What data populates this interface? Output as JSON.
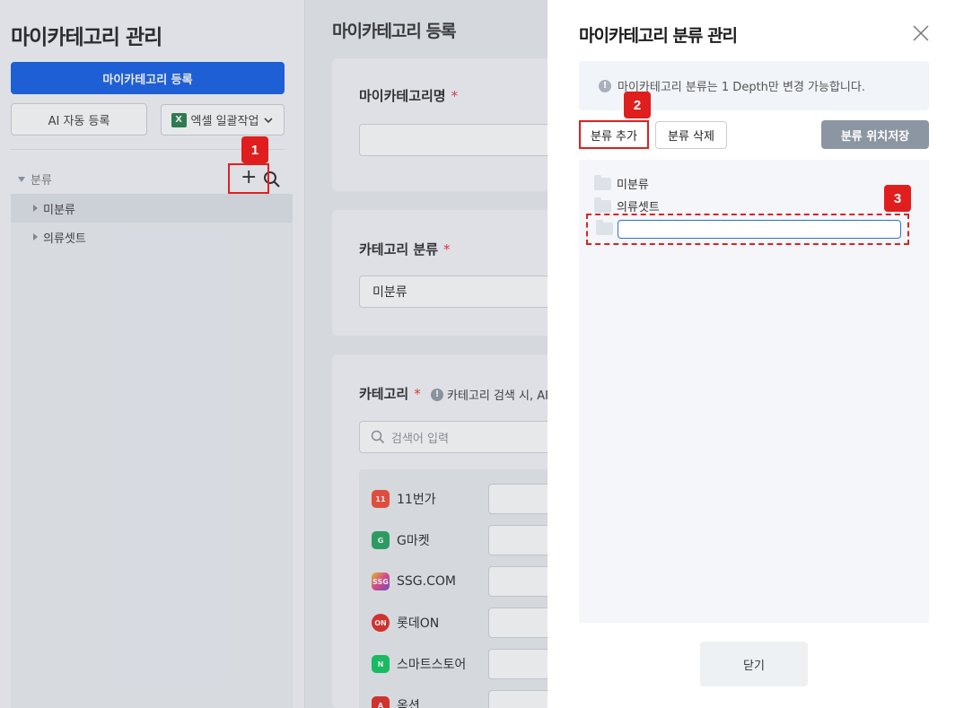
{
  "sidebar": {
    "title": "마이카테고리 관리",
    "register_button": "마이카테고리 등록",
    "ai_button": "AI 자동 등록",
    "excel_button": "엑셀 일괄작업",
    "excel_icon_letter": "X",
    "tree_header": "분류",
    "tree_items": [
      {
        "label": "미분류"
      },
      {
        "label": "의류셋트"
      }
    ]
  },
  "main": {
    "title": "마이카테고리 등록",
    "name_label": "마이카테고리명",
    "required_mark": "*",
    "class_label": "카테고리 분류",
    "class_value": "미분류",
    "category_label": "카테고리",
    "category_info": "카테고리 검색 시, AI기",
    "search_placeholder": "검색어 입력",
    "markets": [
      {
        "name": "11번가",
        "logo_text": "11",
        "color": "#f4442e"
      },
      {
        "name": "G마켓",
        "logo_text": "G",
        "color": "#1ca15a"
      },
      {
        "name": "SSG.COM",
        "logo_text": "SSG",
        "color": "#d63384"
      },
      {
        "name": "롯데ON",
        "logo_text": "ON",
        "color": "#e2211c"
      },
      {
        "name": "스마트스토어",
        "logo_text": "N",
        "color": "#03c75a"
      },
      {
        "name": "옥션",
        "logo_text": "A",
        "color": "#e2211c"
      }
    ]
  },
  "modal": {
    "title": "마이카테고리 분류 관리",
    "notice": "마이카테고리 분류는 1 Depth만 변경 가능합니다.",
    "add_button": "분류 추가",
    "delete_button": "분류 삭제",
    "save_position_button": "분류 위치저장",
    "folders": [
      {
        "label": "미분류"
      },
      {
        "label": "의류셋트"
      }
    ],
    "new_folder_value": "",
    "close_button": "닫기"
  },
  "callouts": [
    "1",
    "2",
    "3"
  ],
  "colors": {
    "primary": "#0a58e6",
    "highlight": "#e02020",
    "save_button": "#8c96a3"
  }
}
